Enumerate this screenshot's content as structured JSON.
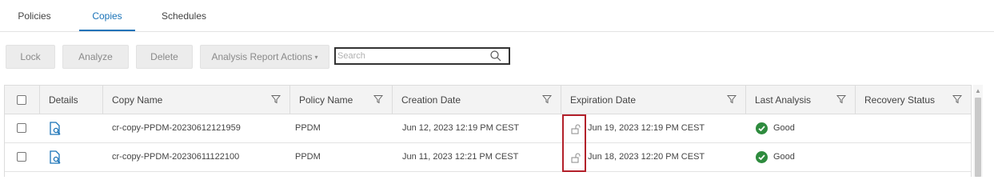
{
  "tabs": [
    {
      "label": "Policies"
    },
    {
      "label": "Copies"
    },
    {
      "label": "Schedules"
    }
  ],
  "active_tab": "Copies",
  "toolbar": {
    "lock_label": "Lock",
    "analyze_label": "Analyze",
    "delete_label": "Delete",
    "analysis_report_label": "Analysis Report Actions"
  },
  "search": {
    "placeholder": "Search",
    "value": ""
  },
  "table": {
    "columns": [
      {
        "label": ""
      },
      {
        "label": "Details"
      },
      {
        "label": "Copy Name"
      },
      {
        "label": "Policy Name"
      },
      {
        "label": "Creation Date"
      },
      {
        "label": "Expiration Date"
      },
      {
        "label": "Last Analysis"
      },
      {
        "label": "Recovery Status"
      }
    ],
    "rows": [
      {
        "copy_name": "cr-copy-PPDM-20230612121959",
        "policy_name": "PPDM",
        "creation_date": "Jun 12, 2023 12:19 PM CEST",
        "expiration_date": "Jun 19, 2023 12:19 PM CEST",
        "last_analysis": "Good",
        "recovery_status": ""
      },
      {
        "copy_name": "cr-copy-PPDM-20230611122100",
        "policy_name": "PPDM",
        "creation_date": "Jun 11, 2023 12:21 PM CEST",
        "expiration_date": "Jun 18, 2023 12:20 PM CEST",
        "last_analysis": "Good",
        "recovery_status": ""
      }
    ]
  },
  "colors": {
    "accent": "#1a73b8",
    "highlight_box": "#b3202a",
    "good": "#2e8b3e"
  }
}
